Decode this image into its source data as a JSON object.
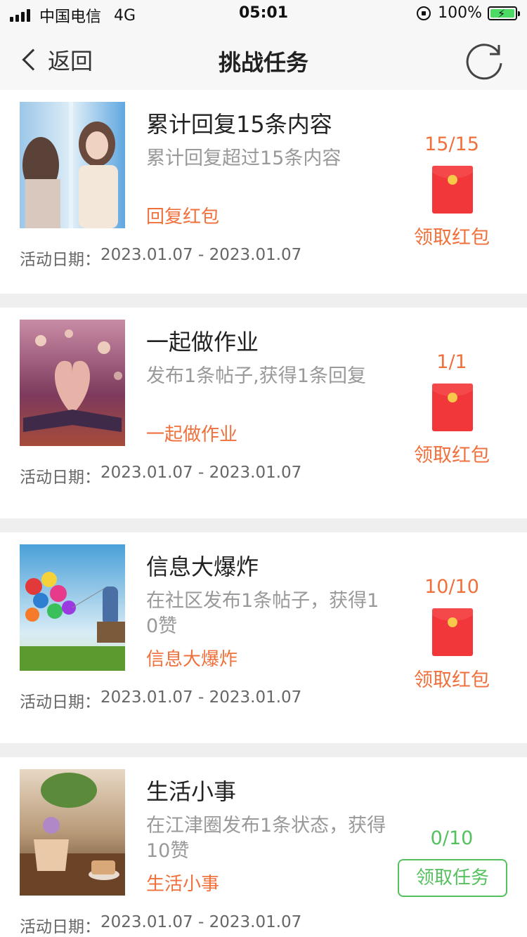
{
  "status_bar": {
    "carrier": "中国电信",
    "network": "4G",
    "time": "05:01",
    "battery": "100%"
  },
  "nav": {
    "back_label": "返回",
    "title": "挑战任务"
  },
  "tasks": [
    {
      "title": "累计回复15条内容",
      "desc": "累计回复超过15条内容",
      "tag": "回复红包",
      "date_label": "活动日期：",
      "date_range": "2023.01.07 - 2023.01.07",
      "progress": "15/15",
      "action": "领取红包"
    },
    {
      "title": "一起做作业",
      "desc": "发布1条帖子,获得1条回复",
      "tag": "一起做作业",
      "date_label": "活动日期：",
      "date_range": "2023.01.07 - 2023.01.07",
      "progress": "1/1",
      "action": "领取红包"
    },
    {
      "title": "信息大爆炸",
      "desc": "在社区发布1条帖子，获得10赞",
      "tag": "信息大爆炸",
      "date_label": "活动日期：",
      "date_range": "2023.01.07 - 2023.01.07",
      "progress": "10/10",
      "action": "领取红包"
    },
    {
      "title": "生活小事",
      "desc": "在江津圈发布1条状态，获得10赞",
      "tag": "生活小事",
      "date_label": "活动日期：",
      "date_range": "2023.01.07 - 2023.01.07",
      "progress": "0/10",
      "action": "领取任务"
    }
  ],
  "colors": {
    "accent_orange": "#f0703c",
    "accent_green": "#54c15e",
    "hongbao_red": "#f1373a"
  },
  "icons": {
    "back": "chevron-left-icon",
    "refresh": "refresh-icon",
    "hongbao": "red-envelope-icon"
  }
}
